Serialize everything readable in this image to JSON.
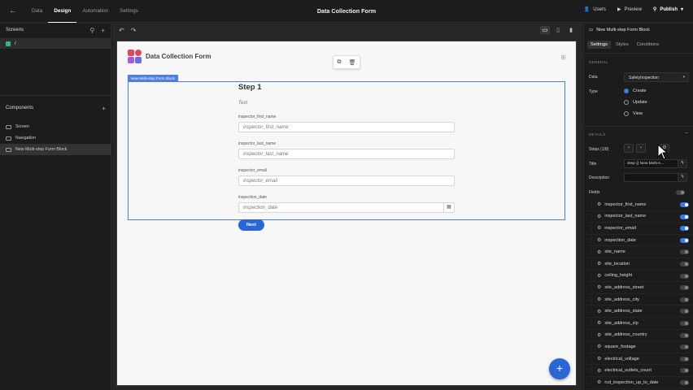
{
  "topbar": {
    "nav": [
      "Data",
      "Design",
      "Automation",
      "Settings"
    ],
    "active_nav": "Design",
    "app_title": "Data Collection Form",
    "users": "Users",
    "preview": "Preview",
    "publish": "Publish"
  },
  "left": {
    "screens_title": "Screens",
    "screen": "/",
    "components_title": "Components",
    "components": [
      "Screen",
      "Navigation",
      "New Multi-step Form Block"
    ]
  },
  "page": {
    "title": "Data Collection Form",
    "block_tag": "New Multi-step Form Block",
    "step_title": "Step 1",
    "step_desc": "Text",
    "fields": [
      {
        "label": "inspector_first_name",
        "placeholder": "inspector_first_name"
      },
      {
        "label": "inspector_last_name",
        "placeholder": "inspector_last_name"
      },
      {
        "label": "inspector_email",
        "placeholder": "inspector_email"
      },
      {
        "label": "inspection_date",
        "placeholder": "inspection_date"
      }
    ],
    "next": "Next",
    "fab": "+"
  },
  "right": {
    "title": "New Multi-step Form Block",
    "tabs": [
      "Settings",
      "Styles",
      "Conditions"
    ],
    "general": "GENERAL",
    "data_label": "Data",
    "data_value": "SafetyInspection",
    "type_label": "Type",
    "type_options": [
      "Create",
      "Update",
      "View"
    ],
    "type_selected": "Create",
    "details": "DETAILS",
    "steps_label": "Steps (1/8)",
    "title_label": "Title",
    "title_value": "Step {{ New Multi-s...",
    "description_label": "Description",
    "fields_label": "Fields",
    "fields": [
      {
        "name": "inspector_first_name",
        "on": true
      },
      {
        "name": "inspector_last_name",
        "on": true
      },
      {
        "name": "inspector_email",
        "on": true
      },
      {
        "name": "inspection_date",
        "on": true
      },
      {
        "name": "site_name",
        "on": false
      },
      {
        "name": "site_location",
        "on": false
      },
      {
        "name": "ceiling_height",
        "on": false
      },
      {
        "name": "site_address_street",
        "on": false
      },
      {
        "name": "site_address_city",
        "on": false
      },
      {
        "name": "site_address_state",
        "on": false
      },
      {
        "name": "site_address_zip",
        "on": false
      },
      {
        "name": "site_address_country",
        "on": false
      },
      {
        "name": "square_footage",
        "on": false
      },
      {
        "name": "electrical_voltage",
        "on": false
      },
      {
        "name": "electrical_outlets_count",
        "on": false
      },
      {
        "name": "rcd_inspection_up_to_date",
        "on": false
      }
    ]
  },
  "colors": {
    "accent": "#2a67d6",
    "selection": "#4d7fe0",
    "screen_icon": "#2db87b"
  }
}
